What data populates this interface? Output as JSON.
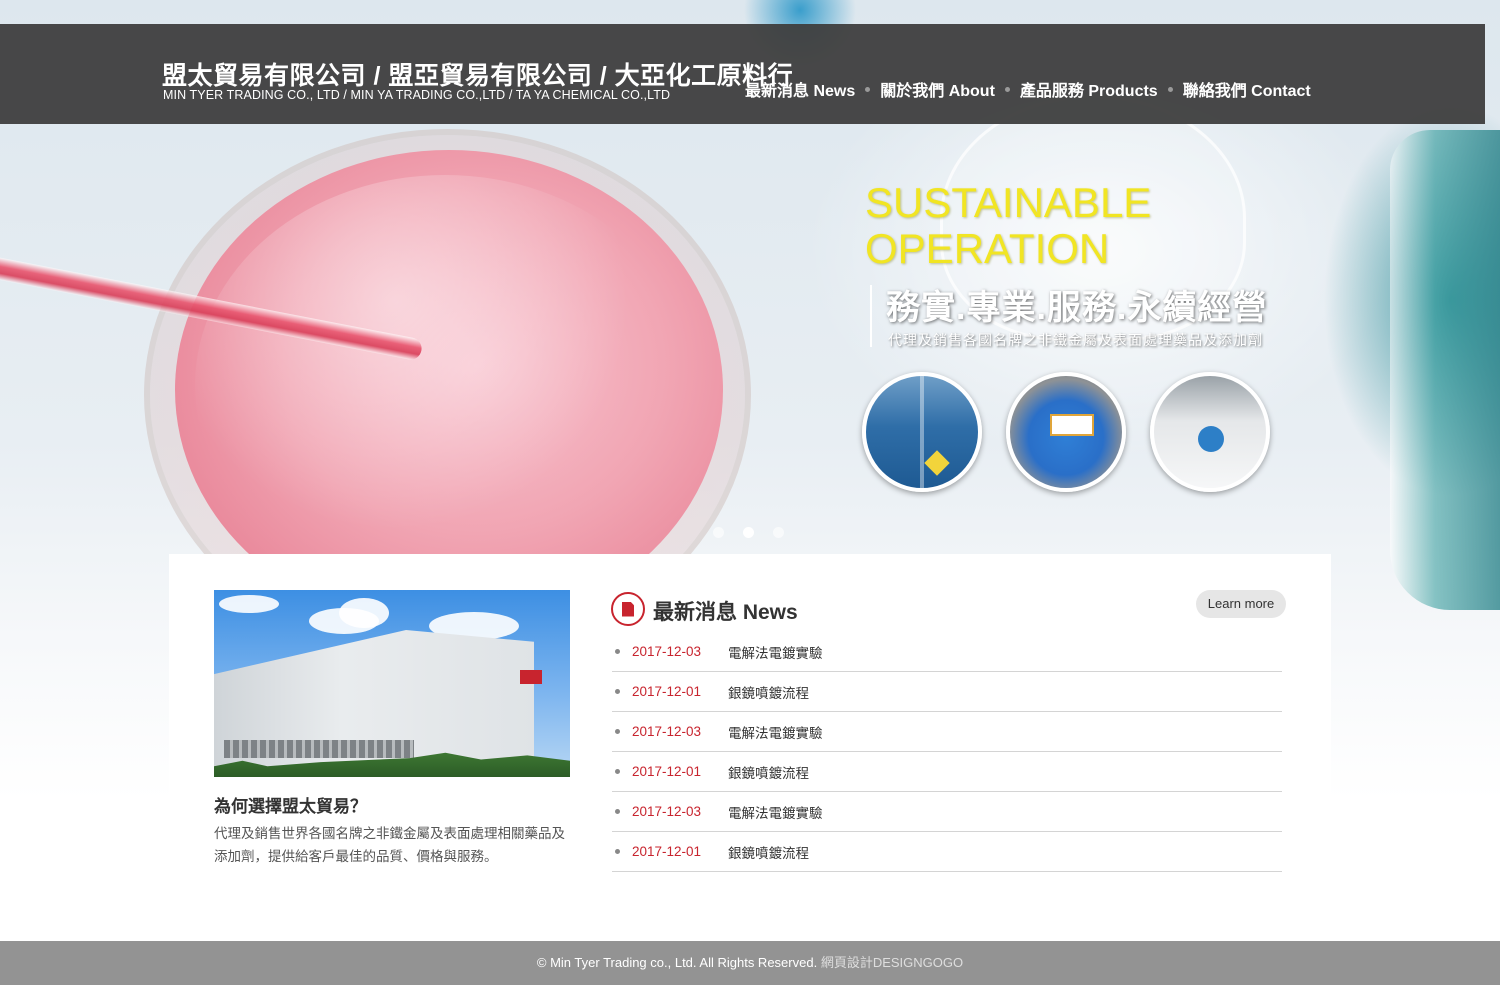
{
  "header": {
    "brand_cn": "盟太貿易有限公司 / 盟亞貿易有限公司 / 大亞化工原料行",
    "brand_en": "MIN TYER TRADING CO., LTD /  MIN YA TRADING CO.,LTD / TA YA CHEMICAL CO.,LTD",
    "nav": [
      {
        "label": "最新消息 News"
      },
      {
        "label": "關於我們 About"
      },
      {
        "label": "產品服務 Products"
      },
      {
        "label": "聯絡我們 Contact"
      }
    ]
  },
  "slider": {
    "title_line1": "SUSTAINABLE",
    "title_line2": "OPERATION",
    "headline": "務實.專業.服務.永續經營",
    "subtitle": "代理及銷售各國名牌之非鐵金屬及表面處理藥品及添加劑",
    "active_slide": 2,
    "slide_count": 3
  },
  "why": {
    "title": "為何選擇盟太貿易？",
    "body": "代理及銷售世界各國名牌之非鐵金屬及表面處理相關藥品及添加劑，提供給客戶最佳的品質、價格與服務。"
  },
  "news": {
    "title": "最新消息 News",
    "learn_more": "Learn more",
    "items": [
      {
        "date": "2017-12-03",
        "title": "電解法電鍍實驗"
      },
      {
        "date": "2017-12-01",
        "title": "銀鏡噴鍍流程"
      },
      {
        "date": "2017-12-03",
        "title": "電解法電鍍實驗"
      },
      {
        "date": "2017-12-01",
        "title": "銀鏡噴鍍流程"
      },
      {
        "date": "2017-12-03",
        "title": "電解法電鍍實驗"
      },
      {
        "date": "2017-12-01",
        "title": "銀鏡噴鍍流程"
      }
    ]
  },
  "footer": {
    "copyright": "© Min Tyer Trading co., Ltd. All Rights Reserved.",
    "designer": "網頁設計DESIGNGOGO"
  },
  "colors": {
    "accent_red": "#c8242e",
    "slide_title_yellow": "#f1e523",
    "header_bg": "#3e3e3e",
    "footer_bg": "#939393"
  },
  "icons": {
    "news_icon": "document-icon"
  }
}
